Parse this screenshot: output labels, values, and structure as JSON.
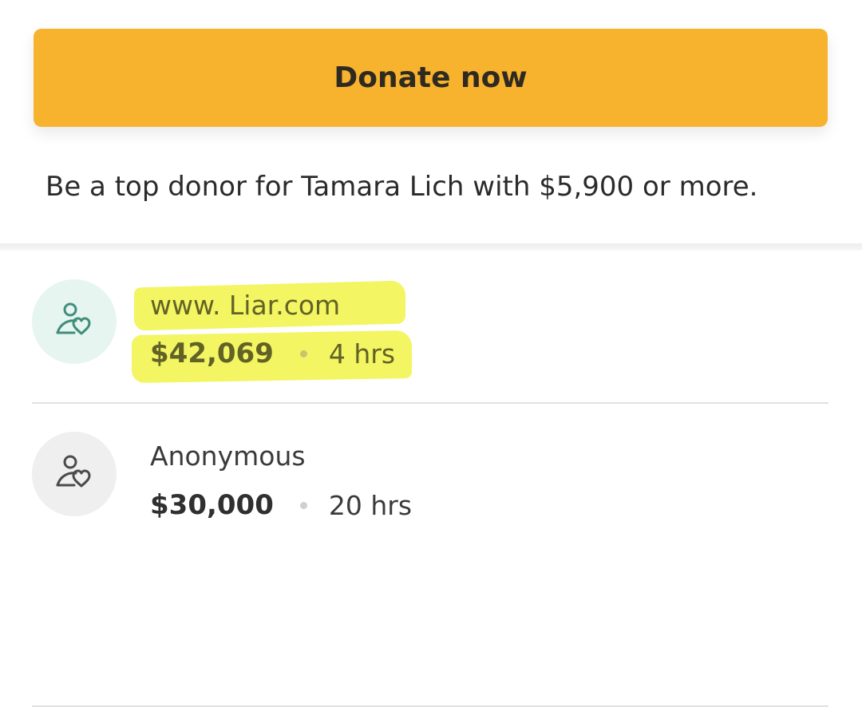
{
  "donate": {
    "button_label": "Donate now",
    "top_donor_text": "Be a top donor for Tamara Lich with $5,900 or more."
  },
  "donations": [
    {
      "name": "www. Liar.com",
      "amount": "$42,069",
      "time": "4 hrs"
    },
    {
      "name": "Anonymous",
      "amount": "$30,000",
      "time": "20 hrs"
    }
  ],
  "colors": {
    "donate_button": "#f8b32e",
    "highlighter": "#eff236",
    "avatar_green": "#e6f5f0",
    "avatar_gray": "#efefef",
    "icon_green": "#3f8e7a",
    "icon_gray": "#4a4a4a"
  },
  "icons": {
    "donor_icon": "donor-heart-icon"
  }
}
